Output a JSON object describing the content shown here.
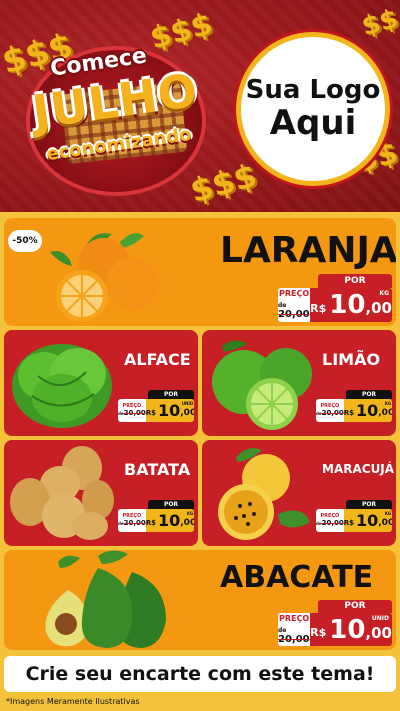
{
  "header": {
    "badge": {
      "word1": "Comece",
      "word2": "JULHO",
      "word3": "economizando"
    },
    "logo": {
      "line1": "Sua Logo",
      "line2": "Aqui"
    },
    "symbols": [
      "$$$",
      "$$$",
      "$$",
      "$$$",
      "$$"
    ]
  },
  "products": {
    "laranja": {
      "name": "LARANJA",
      "discount": "-50%",
      "por": "POR",
      "preco_label": "PREÇO",
      "old_prefix": "de",
      "old_value": "20,00",
      "currency": "R$",
      "int": "10",
      "cents": ",00",
      "unit": "KG"
    },
    "alface": {
      "name": "ALFACE",
      "por": "POR",
      "preco_label": "PREÇO",
      "old_prefix": "de",
      "old_value": "20,00",
      "currency": "R$",
      "int": "10",
      "cents": ",00",
      "unit": "UNID"
    },
    "limao": {
      "name": "LIMÃO",
      "por": "POR",
      "preco_label": "PREÇO",
      "old_prefix": "de",
      "old_value": "20,00",
      "currency": "R$",
      "int": "10",
      "cents": ",00",
      "unit": "KG"
    },
    "batata": {
      "name": "BATATA",
      "por": "POR",
      "preco_label": "PREÇO",
      "old_prefix": "de",
      "old_value": "20,00",
      "currency": "R$",
      "int": "10",
      "cents": ",00",
      "unit": "KG"
    },
    "maracuja": {
      "name": "MARACUJÁ",
      "por": "POR",
      "preco_label": "PREÇO",
      "old_prefix": "de",
      "old_value": "20,00",
      "currency": "R$",
      "int": "10",
      "cents": ",00",
      "unit": "KG"
    },
    "abacate": {
      "name": "ABACATE",
      "por": "POR",
      "preco_label": "PREÇO",
      "old_prefix": "de",
      "old_value": "20,00",
      "currency": "R$",
      "int": "10",
      "cents": ",00",
      "unit": "UNID"
    }
  },
  "footer": {
    "cta": "Crie seu encarte com este tema!",
    "note": "*Imagens Meramente Ilustrativas"
  },
  "colors": {
    "red": "#c61f25",
    "orange": "#f49812",
    "yellow": "#f2b51c",
    "background": "#f3c23a"
  }
}
